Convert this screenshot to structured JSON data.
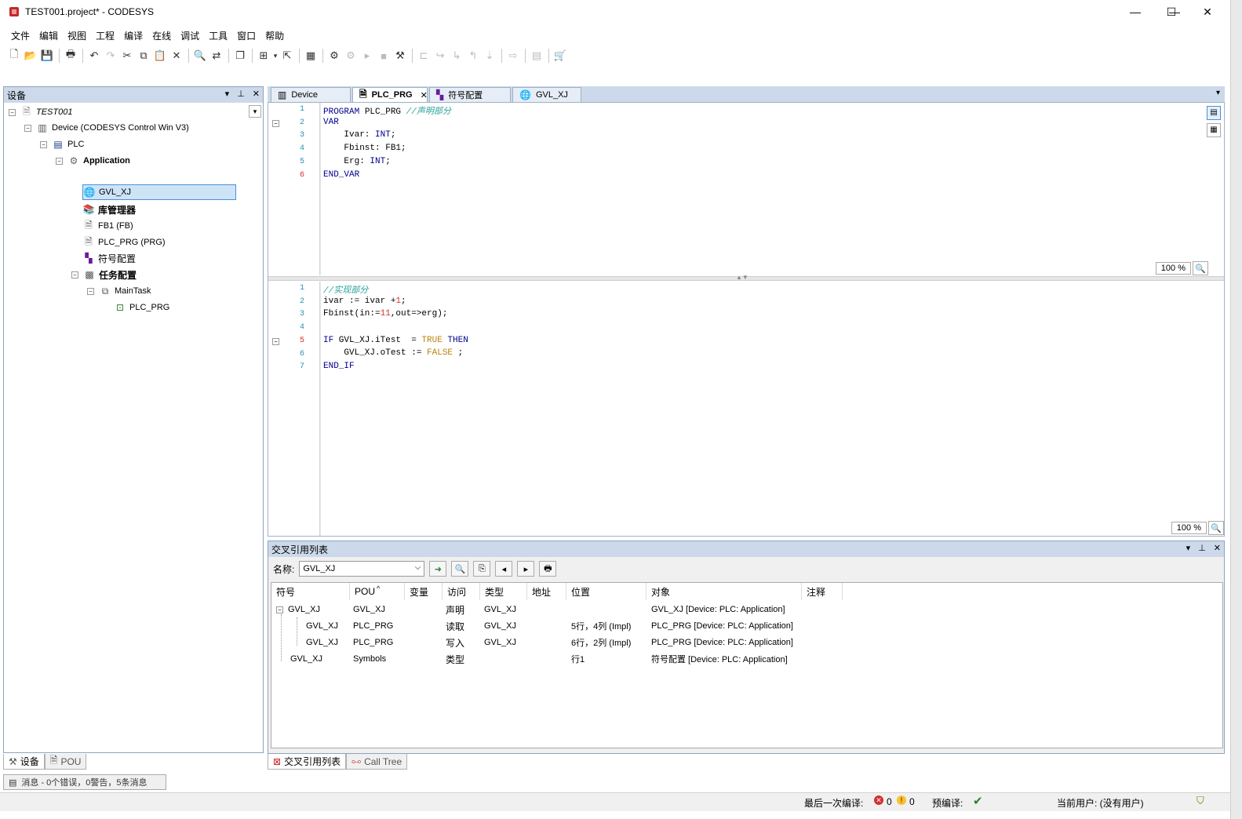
{
  "window": {
    "title": "TEST001.project* - CODESYS",
    "minimize": "—",
    "maximize": "☐",
    "close": "✕"
  },
  "menu": [
    "文件",
    "编辑",
    "视图",
    "工程",
    "编译",
    "在线",
    "调试",
    "工具",
    "窗口",
    "帮助"
  ],
  "device_panel": {
    "title": "设备",
    "header_buttons": [
      "▾",
      "⊥",
      "✕"
    ],
    "tree": {
      "root": "TEST001",
      "device": "Device (CODESYS Control Win V3)",
      "plc": "PLC",
      "application": "Application",
      "gvl": "GVL_XJ",
      "library": "库管理器",
      "fb1": "FB1 (FB)",
      "plc_prg": "PLC_PRG (PRG)",
      "symbol": "符号配置",
      "task_config": "任务配置",
      "main_task": "MainTask",
      "task_prg": "PLC_PRG"
    },
    "bottom_tabs": [
      "设备",
      "POU"
    ]
  },
  "editor_tabs": [
    {
      "label": "Device",
      "icon": "device-icon"
    },
    {
      "label": "PLC_PRG",
      "icon": "document-icon",
      "active": true,
      "close": "✕"
    },
    {
      "label": "符号配置",
      "icon": "symbol-icon"
    },
    {
      "label": "GVL_XJ",
      "icon": "globe-icon"
    }
  ],
  "declaration": {
    "lines": [
      {
        "n": "1",
        "text": "PROGRAM PLC_PRG //声明部分"
      },
      {
        "n": "2",
        "text": "VAR"
      },
      {
        "n": "3",
        "text": "    Ivar: INT;"
      },
      {
        "n": "4",
        "text": "    Fbinst: FB1;"
      },
      {
        "n": "5",
        "text": "    Erg: INT;"
      },
      {
        "n": "6",
        "text": "END_VAR"
      }
    ],
    "zoom": "100 %"
  },
  "implementation": {
    "lines": [
      {
        "n": "1",
        "text": "//实现部分"
      },
      {
        "n": "2",
        "text": "ivar := ivar +1;"
      },
      {
        "n": "3",
        "text": "Fbinst(in:=11,out=>erg);"
      },
      {
        "n": "4",
        "text": ""
      },
      {
        "n": "5",
        "text": "IF GVL_XJ.iTest  = TRUE THEN"
      },
      {
        "n": "6",
        "text": "    GVL_XJ.oTest := FALSE ;"
      },
      {
        "n": "7",
        "text": "END_IF"
      }
    ],
    "zoom": "100 %"
  },
  "xref": {
    "title": "交叉引用列表",
    "name_label": "名称:",
    "name_value": "GVL_XJ",
    "columns": [
      "符号",
      "POU",
      "变量",
      "访问",
      "类型",
      "地址",
      "位置",
      "对象",
      "注释"
    ],
    "rows": [
      {
        "symbol": "GVL_XJ",
        "pou": "GVL_XJ",
        "var": "",
        "access": "声明",
        "type": "GVL_XJ",
        "addr": "",
        "pos": "",
        "obj": "GVL_XJ [Device: PLC: Application]"
      },
      {
        "symbol": "GVL_XJ",
        "pou": "PLC_PRG",
        "var": "",
        "access": "读取",
        "type": "GVL_XJ",
        "addr": "",
        "pos": "5行，4列 (Impl)",
        "obj": "PLC_PRG [Device: PLC: Application]"
      },
      {
        "symbol": "GVL_XJ",
        "pou": "PLC_PRG",
        "var": "",
        "access": "写入",
        "type": "GVL_XJ",
        "addr": "",
        "pos": "6行，2列 (Impl)",
        "obj": "PLC_PRG [Device: PLC: Application]"
      },
      {
        "symbol": "GVL_XJ",
        "pou": "Symbols",
        "var": "",
        "access": "类型",
        "type": "",
        "addr": "",
        "pos": "行1",
        "obj": "符号配置 [Device: PLC: Application]"
      }
    ],
    "bottom_tabs": [
      "交叉引用列表",
      "Call Tree"
    ]
  },
  "messages_tab": "消息 - 0个错误，0警告，5条消息",
  "status": {
    "last_build": "最后一次编译:",
    "errors": "0",
    "warnings": "0",
    "precompile": "预编译:",
    "current_user": "当前用户: (没有用户)"
  },
  "colors": {
    "panel_header": "#ccd9ea",
    "keyword": "#00008b",
    "comment": "#2aa198",
    "number": "#d32f2f",
    "literal": "#b8860b"
  }
}
